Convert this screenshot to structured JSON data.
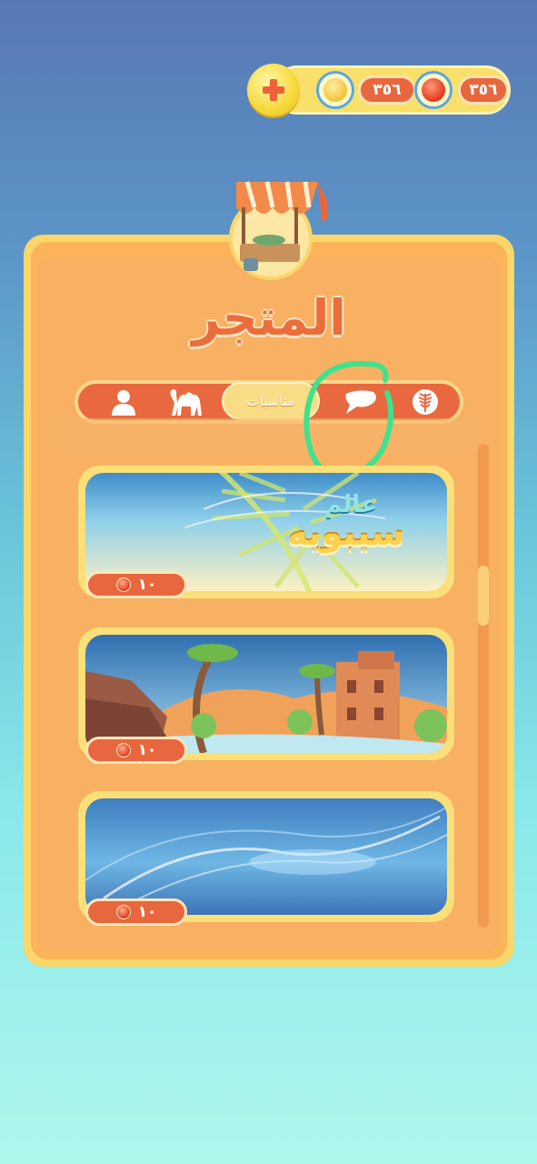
{
  "currency": {
    "add_button_icon": "plus-icon",
    "gems": {
      "icon": "gold-wheat-coin-icon",
      "value": "٣٥٦"
    },
    "coins": {
      "icon": "red-gem-icon",
      "value": "٣٥٦"
    }
  },
  "shop": {
    "icon": "market-stall-icon",
    "title": "المتجر",
    "tabs": [
      {
        "icon": "profile-icon"
      },
      {
        "icon": "camel-icon"
      },
      {
        "label": "مناسبات",
        "active": true
      },
      {
        "icon": "flag-icon"
      },
      {
        "icon": "palm-leaf-icon"
      }
    ],
    "items": [
      {
        "title_line1": "عالم",
        "title_line2": "سيبويه",
        "price": "١٠",
        "theme": "palm-sky"
      },
      {
        "price": "١٠",
        "theme": "desert-oasis"
      },
      {
        "price": "١٠",
        "theme": "blue-waves"
      }
    ]
  },
  "colors": {
    "accent": "#e8673e",
    "panel": "#f8b062",
    "gold": "#fbd668"
  }
}
